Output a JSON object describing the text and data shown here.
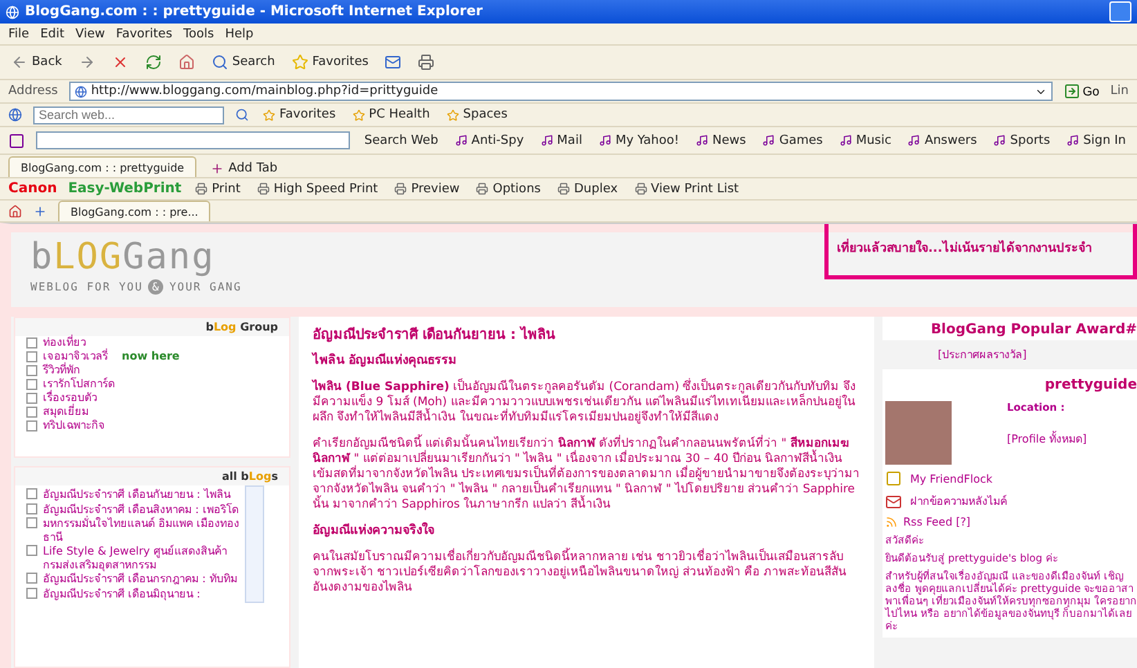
{
  "window": {
    "title": "BlogGang.com : : prettyguide - Microsoft Internet Explorer"
  },
  "menu": [
    "File",
    "Edit",
    "View",
    "Favorites",
    "Tools",
    "Help"
  ],
  "toolbar": {
    "back": "Back",
    "search": "Search",
    "favorites": "Favorites"
  },
  "address": {
    "label": "Address",
    "url": "http://www.bloggang.com/mainblog.php?id=prittyguide",
    "go": "Go",
    "links": "Lin"
  },
  "search_bar": {
    "placeholder": "Search web...",
    "items": [
      "Favorites",
      "PC Health",
      "Spaces"
    ]
  },
  "yahoo_bar": {
    "search_button": "Search Web",
    "items": [
      "Anti-Spy",
      "Mail",
      "My Yahoo!",
      "News",
      "Games",
      "Music",
      "Answers",
      "Sports",
      "Sign In"
    ]
  },
  "tabs": [
    {
      "label": "BlogGang.com : : prettyguide",
      "selected": true
    }
  ],
  "add_tab": "Add Tab",
  "canon_bar": {
    "brand": "Canon",
    "product": "Easy-WebPrint",
    "items": [
      "Print",
      "High Speed Print",
      "Preview",
      "Options",
      "Duplex",
      "View Print List"
    ]
  },
  "ie_tab": "BlogGang.com : : pre...",
  "site": {
    "logo": [
      "b",
      "LOG",
      "Gang"
    ],
    "tagline": [
      "WEBLOG FOR YOU",
      "&",
      "YOUR GANG"
    ],
    "banner": "เที่ยวแล้วสบายใจ...ไม่เน้นรายได้จากงานประจำ"
  },
  "group": {
    "title": [
      "b",
      "Log",
      " Group"
    ],
    "items": [
      {
        "label": "ท่องเที่ยว"
      },
      {
        "label": "เจอมาจิวเวลรี่",
        "badge": "now here"
      },
      {
        "label": "รีวิวที่พัก"
      },
      {
        "label": "เรารักโปสการ์ด"
      },
      {
        "label": "เรื่องรอบตัว"
      },
      {
        "label": "สมุดเยี่ยม"
      },
      {
        "label": "ทริปเฉพาะกิจ"
      }
    ]
  },
  "all_blogs": {
    "title": [
      "all b",
      "Log",
      "s"
    ],
    "items": [
      "อัญมณีประจำราศี เดือนกันยายน : ไพลิน",
      "อัญมณีประจำราศี เดือนสิงหาคม : เพอริโด",
      "มหกรรมมั่นใจไทยแลนด์ อิมแพค เมืองทองธานี",
      "Life Style & Jewelry ศูนย์แสดงสินค้ากรมส่งเสริมอุตสาหกรรม",
      "อัญมณีประจำราศี เดือนกรกฎาคม : ทับทิม",
      "อัญมณีประจำราศี เดือนมิถุนายน :"
    ]
  },
  "article": {
    "blocks": [
      {
        "kind": "title",
        "text": "อัญมณีประจำราศี เดือนกันยายน : ไพลิน"
      },
      {
        "kind": "heading",
        "text": "ไพลิน อัญมณีแห่งคุณธรรม"
      },
      {
        "kind": "paragraph",
        "text": "**ไพลิน (Blue Sapphire)** เป็นอัญมณีในตระกูลคอรันดัม (Corandam) ซึ่งเป็นตระกูลเดียวกันกับทับทิม จึงมีความแข็ง 9 โมส์ (Moh) และมีความวาวแบบเพชรเช่นเดียวกัน แต่ไพลินมีแร่ไทเทเนียมและเหล็กปนอยู่ในผลึก จึงทำให้ไพลินมีสีน้ำเงิน ในขณะที่ทับทิมมีแร่โครเมียมปนอยู่จึงทำให้มีสีแดง"
      },
      {
        "kind": "paragraph",
        "text": "คำเรียกอัญมณีชนิดนี้ แต่เดิมนั้นคนไทยเรียกว่า **นิลกาฬ** ดังที่ปรากฏในคำกลอนนพรัตน์ที่ว่า \" **สีหมอกเมฆนิลกาฬ** \" แต่ต่อมาเปลี่ยนมาเรียกกันว่า \" ไพลิน \" เนื่องจาก เมื่อประมาณ 30 – 40 ปีก่อน นิลกาฬสีน้ำเงินเข้มสดที่มาจากจังหวัดไพลิน ประเทศเขมรเป็นที่ต้องการของตลาดมาก เมื่อผู้ขายนำมาขายจึงต้องระบุว่ามาจากจังหวัดไพลิน จนคำว่า \" ไพลิน \" กลายเป็นคำเรียกแทน \" นิลกาฬ \" ไปโดยปริยาย ส่วนคำว่า Sapphire นั้น มาจากคำว่า Sapphiros ในภาษากรีก แปลว่า สีน้ำเงิน"
      },
      {
        "kind": "heading",
        "text": "อัญมณีแห่งความจริงใจ"
      },
      {
        "kind": "paragraph",
        "text": "คนในสมัยโบราณมีความเชื่อเกี่ยวกับอัญมณีชนิดนี้หลากหลาย เช่น ชาวยิวเชื่อว่าไพลินเป็นเสมือนสารลับจากพระเจ้า ชาวเปอร์เซียคิดว่าโลกของเราวางอยู่เหนือไพลินขนาดใหญ่ ส่วนท้องฟ้า คือ ภาพสะท้อนสีสันอันงดงามของไพลิน"
      }
    ]
  },
  "award": {
    "title": "BlogGang Popular Award#",
    "link": "[ประกาศผลรางวัล]"
  },
  "profile": {
    "name": "prettyguide",
    "location": "Location :",
    "profile_link": "[Profile ทั้งหมด]",
    "friendflock": "My FriendFlock",
    "message": "ฝากข้อความหลังไมค์",
    "rss": "Rss Feed [?]",
    "greeting": "สวัสดีค่ะ",
    "welcome": "ยินดีต้อนรับสู่ prettyguide's blog ค่ะ",
    "intro": "สำหรับผู้ที่สนใจเรื่องอัญมณี และของดีเมืองจันท์ เชิญลงชื่อ พูดคุยแลกเปลี่ยนได้ค่ะ prettyguide จะขออาสาพาเพื่อนๆ เที่ยวเมืองจันท์ให้ครบทุกซอกทุกมุม ใครอยากไปไหน หรือ อยากได้ข้อมูลของจันทบุรี ก็บอกมาได้เลยค่ะ"
  }
}
